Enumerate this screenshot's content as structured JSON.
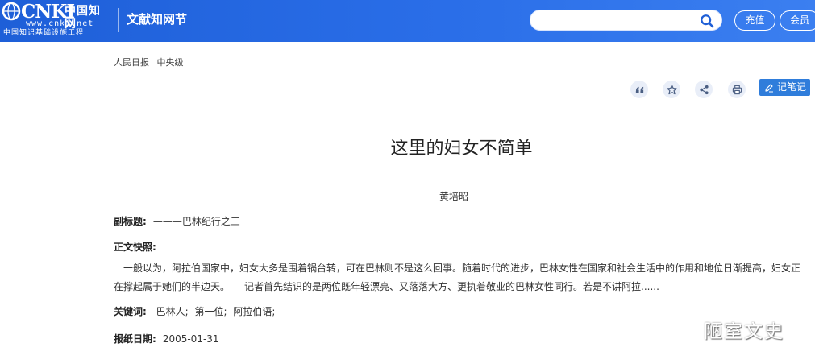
{
  "header": {
    "logo_cnki": "CNKI",
    "logo_cn_name": "中国知网",
    "logo_url": "www.cnki.net",
    "logo_slogan": "中国知识基础设施工程",
    "title": "文献知网节",
    "search": {
      "value": "",
      "placeholder": ""
    },
    "buttons": {
      "recharge": "充值",
      "member": "会员"
    }
  },
  "source": {
    "newspaper": "人民日报",
    "level": "中央级"
  },
  "toolbar": {
    "note_label": "记笔记"
  },
  "article": {
    "title": "这里的妇女不简单",
    "author": "黄培昭",
    "subtitle_label": "副标题:",
    "subtitle_value": "———巴林纪行之三",
    "snapshot_label": "正文快照:",
    "snapshot_text": "一般以为，阿拉伯国家中，妇女大多是围着锅台转，可在巴林则不是这么回事。随着时代的进步，巴林女性在国家和社会生活中的作用和地位日渐提高，妇女正在撑起属于她们的半边天。　　记者首先结识的是两位既年轻漂亮、又落落大方、更执着敬业的巴林女性同行。若是不讲阿拉......",
    "keywords_label": "关键词:",
    "keywords": [
      "巴林人;",
      "第一位;",
      "阿拉伯语;"
    ],
    "date_label": "报纸日期:",
    "date_value": "2005-01-31"
  },
  "watermark": "陋室文史",
  "colors": {
    "header_blue": "#2a6ee8",
    "note_button": "#2f7ddb",
    "tool_bg": "#e9eef8"
  }
}
